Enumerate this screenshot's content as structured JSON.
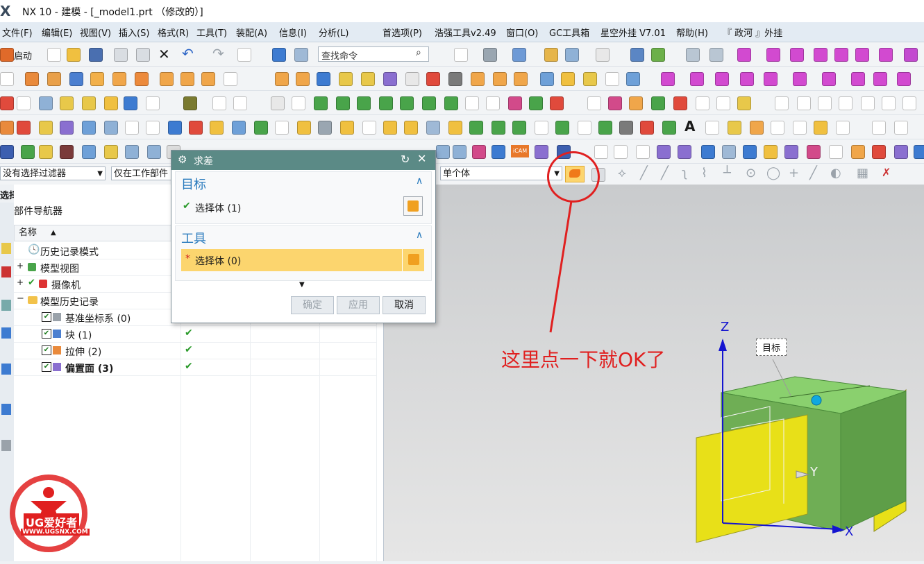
{
  "window": {
    "logo": "X",
    "title": "NX 10 - 建模 - [_model1.prt （修改的）]"
  },
  "menu": [
    "文件(F)",
    "编辑(E)",
    "视图(V)",
    "插入(S)",
    "格式(R)",
    "工具(T)",
    "装配(A)",
    "信息(I)",
    "分析(L)",
    "首选项(P)",
    "浩强工具v2.49",
    "窗口(O)",
    "GC工具箱",
    "星空外挂 V7.01",
    "帮助(H)",
    "『 政河 』外挂"
  ],
  "toolbar": {
    "start_label": "启动",
    "search_placeholder": "查找命令"
  },
  "filter": {
    "type_filter": "没有选择过滤器",
    "scope": "仅在工作部件",
    "body_rule": "单个体"
  },
  "navigator": {
    "header": "选择工具体",
    "title": "部件导航器",
    "column_name": "名称",
    "rows": [
      {
        "label": "历史记录模式",
        "bold": false
      },
      {
        "label": "模型视图",
        "bold": false
      },
      {
        "label": "摄像机",
        "bold": false
      },
      {
        "label": "模型历史记录",
        "bold": false
      },
      {
        "label": "基准坐标系 (0)",
        "bold": false
      },
      {
        "label": "块 (1)",
        "bold": false
      },
      {
        "label": "拉伸 (2)",
        "bold": false
      },
      {
        "label": "偏置面 (3)",
        "bold": true
      }
    ],
    "check_mark": "✔"
  },
  "dialog": {
    "title": "求差",
    "section_target": "目标",
    "target_select": "选择体 (1)",
    "section_tool": "工具",
    "tool_select": "选择体 (0)",
    "required_marker": "*",
    "ok_label": "确定",
    "apply_label": "应用",
    "cancel_label": "取消"
  },
  "viewport": {
    "axis_x": "X",
    "axis_y": "Y",
    "axis_z": "Z",
    "target_tag": "目标"
  },
  "annotation": {
    "text": "这里点一下就OK了",
    "color": "#e02020"
  },
  "watermark": {
    "brand": "UG爱好者",
    "url": "WWW.UGSNX.COM"
  },
  "colors": {
    "dialog_title_bg": "#5b8a86",
    "highlight": "#fcd56e",
    "body_green": "#6fbf5c",
    "sheet_yellow": "#e8e018"
  }
}
